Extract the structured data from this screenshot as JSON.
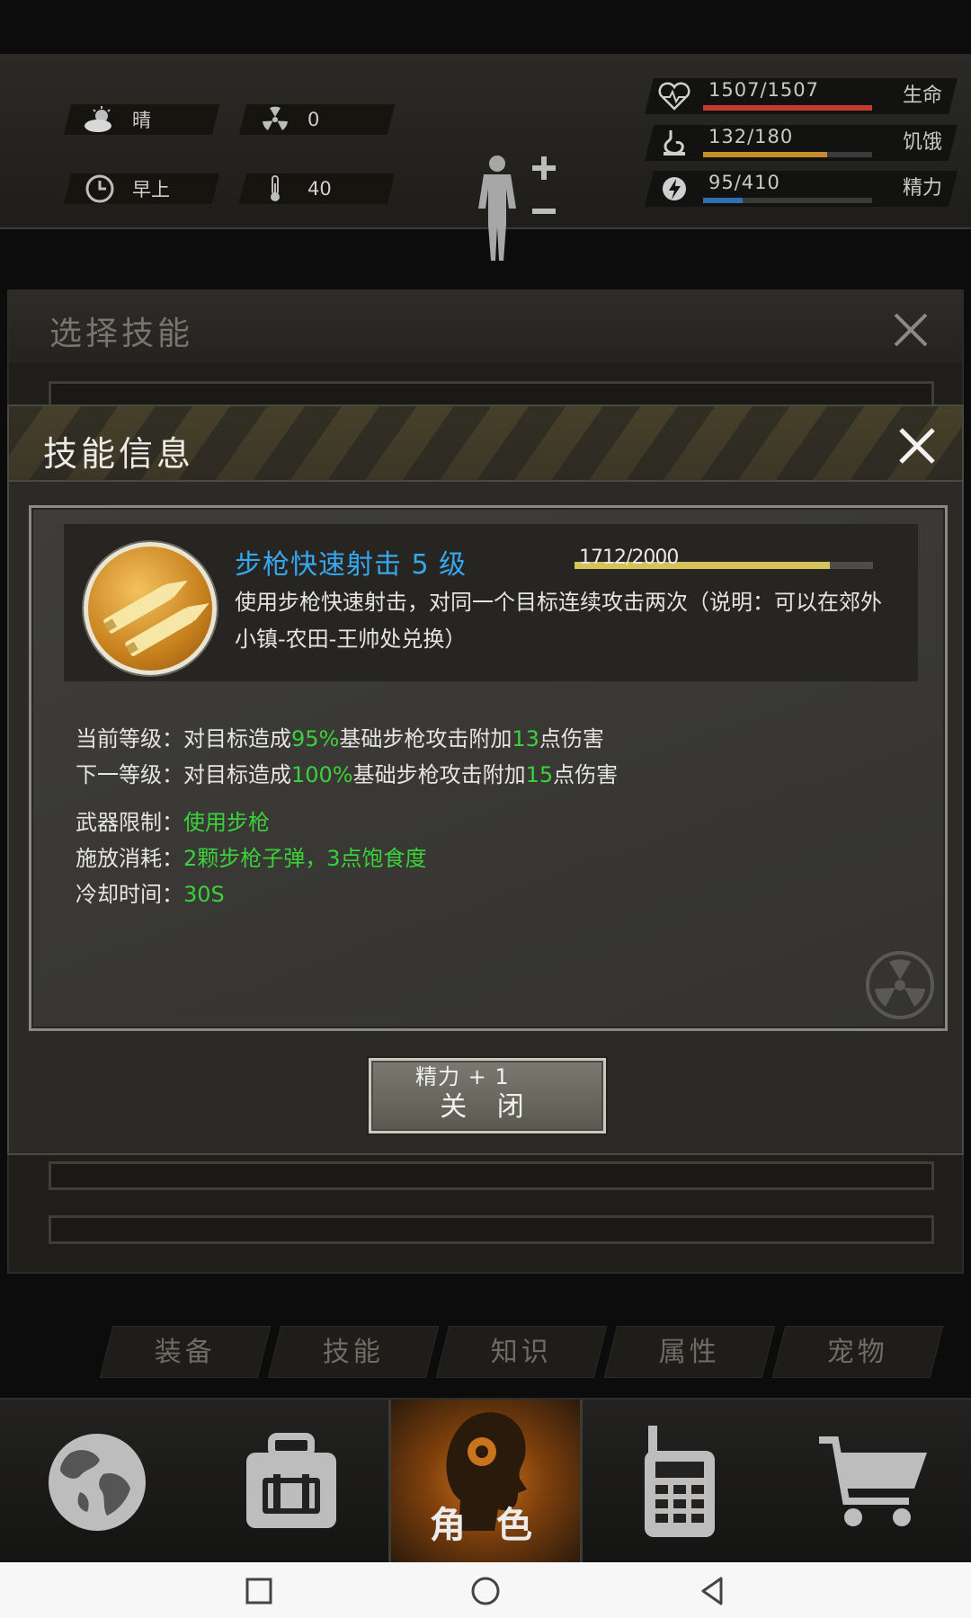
{
  "status": {
    "weather": "晴",
    "radiation": "0",
    "time_of_day": "早上",
    "temperature": "40",
    "stats": [
      {
        "label": "生命",
        "value_text": "1507/1507",
        "ratio": 1.0,
        "color": "#c43a2b",
        "icon": "heart-icon"
      },
      {
        "label": "饥饿",
        "value_text": "132/180",
        "ratio": 0.733,
        "color": "#c98a2a",
        "icon": "stomach-icon"
      },
      {
        "label": "精力",
        "value_text": "95/410",
        "ratio": 0.232,
        "color": "#2f6fb2",
        "icon": "energy-icon"
      }
    ]
  },
  "back_panel": {
    "title": "选择技能"
  },
  "dialog": {
    "title": "技能信息",
    "skill": {
      "name": "步枪快速射击 5 级",
      "xp_text": "1712/2000",
      "xp_ratio": 0.856,
      "description": "使用步枪快速射击，对同一个目标连续攻击两次（说明：可以在郊外小镇-农田-王帅处兑换）",
      "icon": "rifle-bullets-icon"
    },
    "details": {
      "current_label": "当前等级：",
      "current_pre": "对目标造成",
      "current_pct": "95%",
      "current_mid": "基础步枪攻击附加",
      "current_num": "13",
      "current_post": "点伤害",
      "next_label": "下一等级：",
      "next_pre": "对目标造成",
      "next_pct": "100%",
      "next_mid": "基础步枪攻击附加",
      "next_num": "15",
      "next_post": "点伤害",
      "weapon_label": "武器限制：",
      "weapon_value": "使用步枪",
      "cost_label": "施放消耗：",
      "cost_value": "2颗步枪子弹，3点饱食度",
      "cooldown_label": "冷却时间：",
      "cooldown_value": "30S"
    },
    "close_button": "关 闭",
    "float_text": "精力 + 1"
  },
  "tabs": [
    "装备",
    "技能",
    "知识",
    "属性",
    "宠物"
  ],
  "active_tab": 1,
  "bottom_nav": {
    "items": [
      {
        "icon": "globe-icon"
      },
      {
        "icon": "backpack-icon"
      },
      {
        "icon": "character-head-icon",
        "label": "角 色"
      },
      {
        "icon": "radio-icon"
      },
      {
        "icon": "cart-icon"
      }
    ],
    "active": 2
  }
}
